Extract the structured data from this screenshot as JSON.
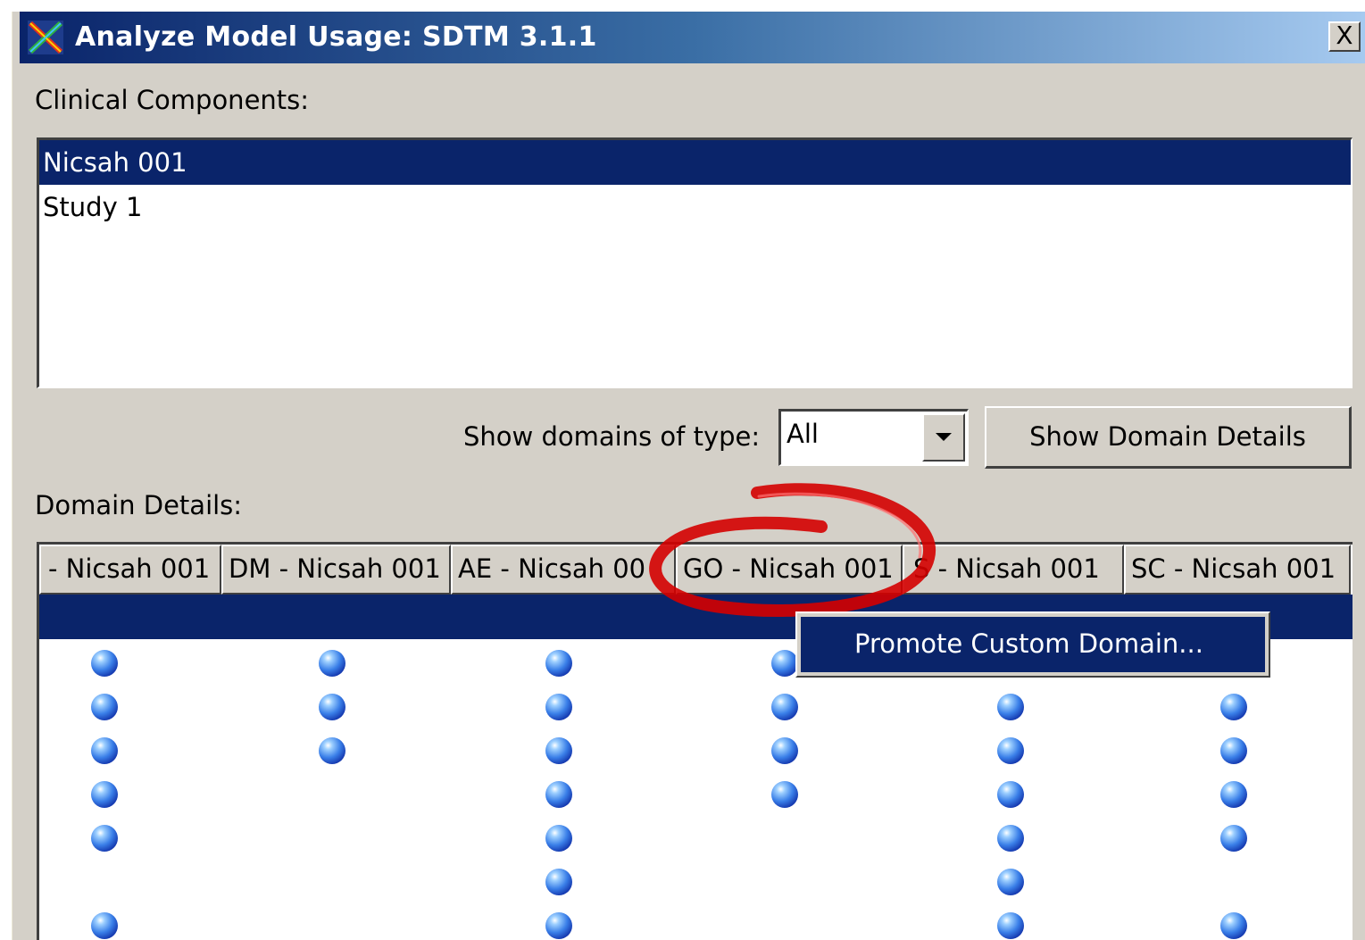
{
  "window": {
    "title": "Analyze Model Usage:  SDTM 3.1.1",
    "close_label": "X"
  },
  "clinical_components": {
    "label": "Clinical Components:",
    "items": [
      {
        "label": "Nicsah 001",
        "selected": true
      },
      {
        "label": "Study 1",
        "selected": false
      }
    ]
  },
  "filter": {
    "label": "Show domains of type:",
    "value": "All"
  },
  "show_details_button": "Show Domain Details",
  "domain_details": {
    "label": "Domain Details:",
    "columns": [
      "- Nicsah 001",
      "DM - Nicsah 001",
      "AE - Nicsah 00",
      "GO - Nicsah 001",
      "S - Nicsah 001",
      "SC - Nicsah 001"
    ]
  },
  "context_menu": {
    "items": [
      "Promote Custom Domain..."
    ]
  },
  "colors": {
    "selection": "#0a246a",
    "annotation": "#d40000",
    "window_bg": "#d4d0c8"
  }
}
